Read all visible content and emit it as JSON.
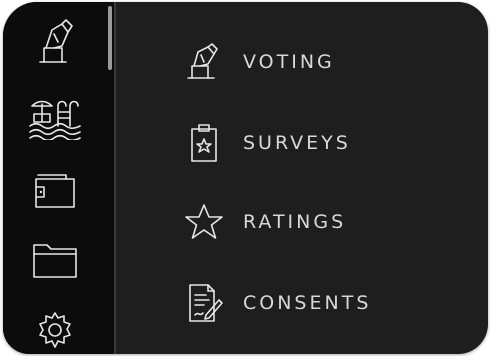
{
  "sidebar": {
    "icons": [
      "ballot-hand-icon",
      "pool-ladder-icon",
      "wallet-icon",
      "folder-icon",
      "gear-icon"
    ]
  },
  "menu": {
    "items": [
      {
        "label": "VOTING",
        "icon": "ballot-hand-icon"
      },
      {
        "label": "SURVEYS",
        "icon": "clipboard-star-icon"
      },
      {
        "label": "RATINGS",
        "icon": "star-icon"
      },
      {
        "label": "CONSENTS",
        "icon": "document-pen-icon"
      }
    ]
  },
  "colors": {
    "sidebar_background": "#0c0c0c",
    "panel_background": "#1e1e1e",
    "text": "#d8d8d8",
    "icon_stroke": "#e6e6e6"
  }
}
